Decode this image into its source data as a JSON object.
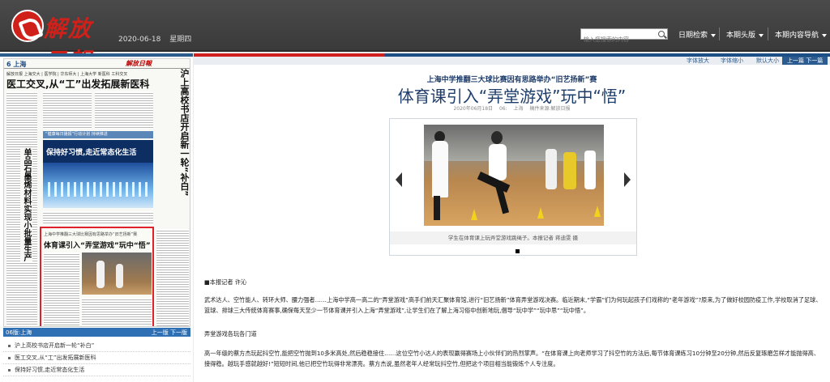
{
  "header": {
    "logo_text": "解放日報",
    "date": "2020-06-18",
    "weekday": "星期四",
    "search_placeholder": "输入您搜索的内容",
    "nav": [
      {
        "label": "日期检索"
      },
      {
        "label": "本期头版"
      },
      {
        "label": "本期内容导航"
      }
    ]
  },
  "left": {
    "newspaper": {
      "page_label": "6 上海",
      "masthead": "解放日報",
      "subline": "解放日报 上海交大 | 医学院 | 华东师大 | 上海大学 新医科 工科交叉",
      "headline": "医工交叉,从“工”出发拓展新医科",
      "vertical_right": "沪上高校书店开启新一轮“补白”",
      "vertical_left": "单品石墨烯材料实现小批量生产",
      "banner_text": "“健康每日播报”行动计划 持续推进",
      "blue_caption": "保持好习惯,走近常态化生活",
      "red_subline": "上海中学推翻三大球比赛因有思路举办“旧艺扬新”赛",
      "red_headline": "体育课引入“弄堂游戏”玩中“悟”"
    },
    "footer_label": "06版:上海",
    "footer_nav": "上一版  下一版",
    "list": [
      {
        "text": "沪上高校书店开启新一轮“补白”"
      },
      {
        "text": "医工交叉,从“工”出发拓展新医科"
      },
      {
        "text": "保持好习惯,走近常态化生活"
      }
    ]
  },
  "right": {
    "toolbar": [
      {
        "label": "字体放大"
      },
      {
        "label": "字体缩小"
      },
      {
        "label": "默认大小"
      },
      {
        "label": "上一篇  下一篇"
      }
    ],
    "kicker": "上海中学推翻三大球比赛因有思路举办“旧艺扬新”赛",
    "headline": "体育课引入“弄堂游戏”玩中“悟”",
    "meta": {
      "date": "2020年06月18日",
      "section": "06:",
      "location": "上海",
      "source": "稿件来源:解放日报"
    },
    "photo_caption": "学生在体育课上玩弄堂游戏跳绳子。本报记者 蒋迪雯 摄",
    "byline": "■本报记者 许沁",
    "paragraphs": [
      "武术达人、空竹能人、转环大师、腰力强者……上海中学高一高二的“弄堂游戏”高手们前天汇聚体育馆,进行“旧艺扬新”体育弄堂游戏决赛。临近期末,“学霸”们为何玩起孩子们戏称的“老年游戏”?原来,为了做好校园防疫工作,学校取消了足球、篮球、排球三大传统体育赛事,确保每天至少一节体育课并引入上海“弄堂游戏”,让学生们在了解上海习俗中创新地玩,倡导“玩中学”“玩中思”“玩中悟”。",
      "弄堂游戏各玩各门道",
      "高一年级的蔡方杰玩起抖空竹,能把空竹抛到10多米高处,然后稳稳接住……这位空竹小达人的表现赢得赛场上小伙伴们的热烈掌声。“在体育课上向老师学习了抖空竹的方法后,每节体育课练习10分钟至20分钟,然后反复琢磨怎样才能抛得高、接得稳。越玩手感就越好!”短短时间,他已把空竹玩得非常漂亮。蔡方杰说,虽然老年人经常玩抖空竹,但把这个项目相当能锻炼个人专注度。"
    ]
  }
}
